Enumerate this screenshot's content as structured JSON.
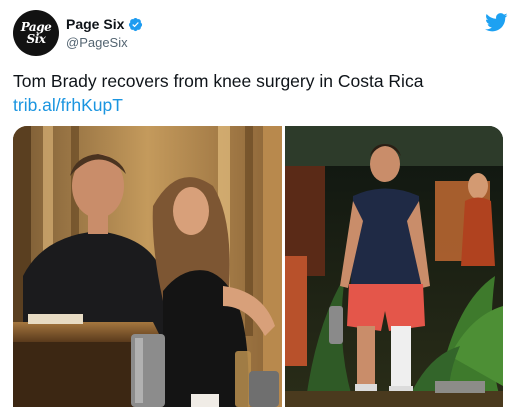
{
  "author": {
    "avatar_text_line1": "Page",
    "avatar_text_line2": "Six",
    "name": "Page Six",
    "handle": "@PageSix",
    "verified": true
  },
  "tweet": {
    "text": "Tom Brady recovers from knee surgery in Costa Rica",
    "link": "trib.al/frhKupT"
  },
  "media": {
    "photos": [
      {
        "icon": "photo-couple-seated"
      },
      {
        "icon": "photo-man-walking"
      }
    ]
  },
  "icons": {
    "verified": "verified-badge-icon",
    "brand": "twitter-bird-icon"
  },
  "colors": {
    "link": "#1b95e0",
    "verified": "#1d9bf0",
    "brand": "#1da1f2"
  }
}
